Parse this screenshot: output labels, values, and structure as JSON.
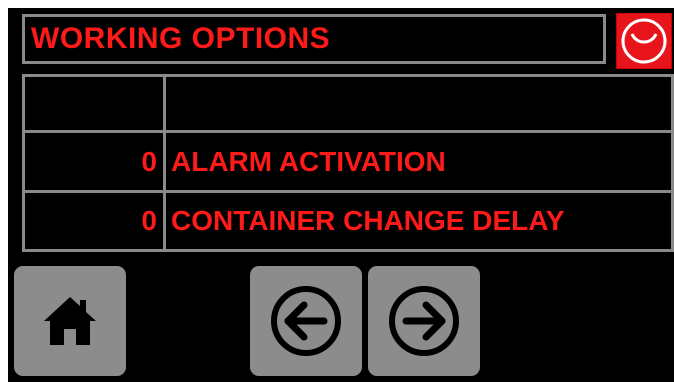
{
  "header": {
    "title": "WORKING OPTIONS",
    "logo_icon": "power-logo-icon"
  },
  "options": [
    {
      "value": "",
      "label": ""
    },
    {
      "value": "0",
      "label": "ALARM ACTIVATION"
    },
    {
      "value": "0",
      "label": "CONTAINER CHANGE DELAY"
    }
  ],
  "nav": {
    "home_icon": "home-icon",
    "prev_icon": "arrow-left-circle-icon",
    "next_icon": "arrow-right-circle-icon"
  },
  "colors": {
    "background": "#000000",
    "text": "#ff1a1a",
    "border": "#8a8a8a",
    "button": "#8c8c8c",
    "logo": "#e8141c"
  }
}
